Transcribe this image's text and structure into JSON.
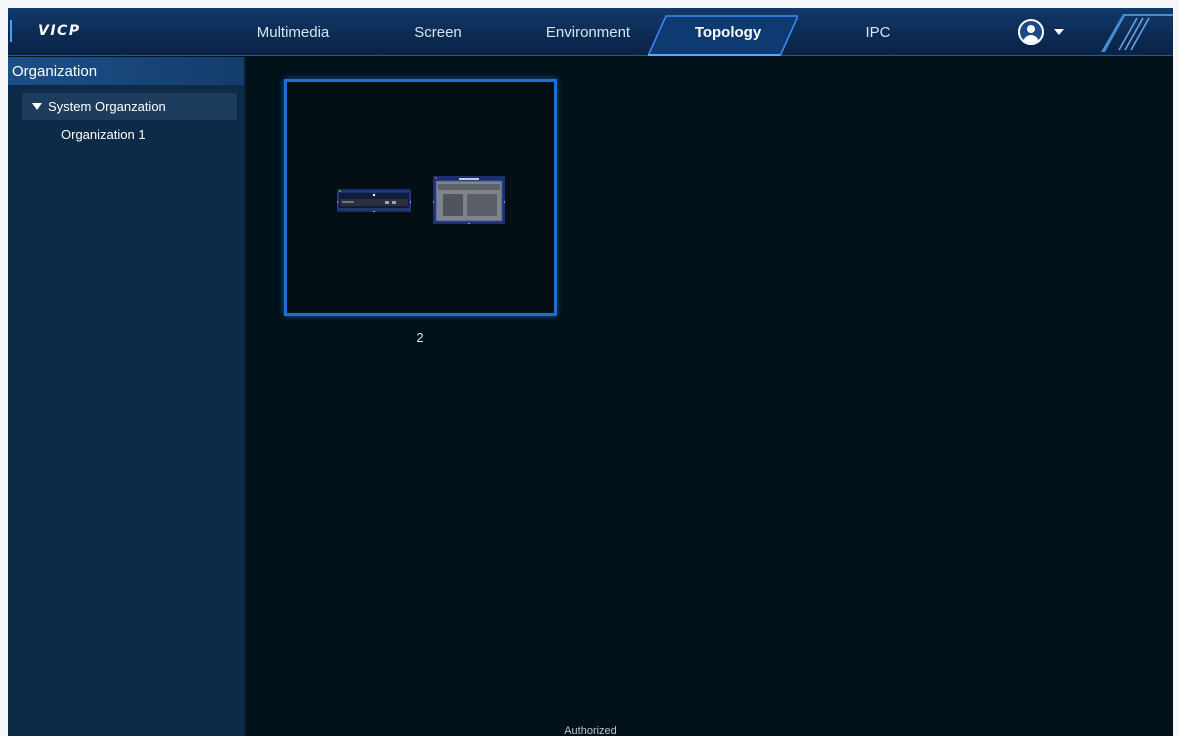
{
  "app": {
    "logo": "VICP",
    "footer": "Authorized"
  },
  "nav": {
    "items": [
      {
        "label": "Multimedia"
      },
      {
        "label": "Screen"
      },
      {
        "label": "Environment"
      },
      {
        "label": "Topology"
      },
      {
        "label": "IPC"
      }
    ],
    "active": "Topology"
  },
  "user": {
    "avatar_icon": "user-avatar-icon",
    "menu_icon": "caret-down-icon"
  },
  "sidebar": {
    "title": "Organization",
    "tree": {
      "root_label": "System Organzation",
      "root_expanded": true,
      "children": [
        {
          "label": "Organization 1"
        }
      ]
    }
  },
  "topology": {
    "cards": [
      {
        "label": "2"
      }
    ]
  },
  "colors": {
    "topbar": "#0c2a52",
    "accent": "#1e6fd4",
    "sidebar": "#0d2a48",
    "canvas": "#02121a"
  }
}
